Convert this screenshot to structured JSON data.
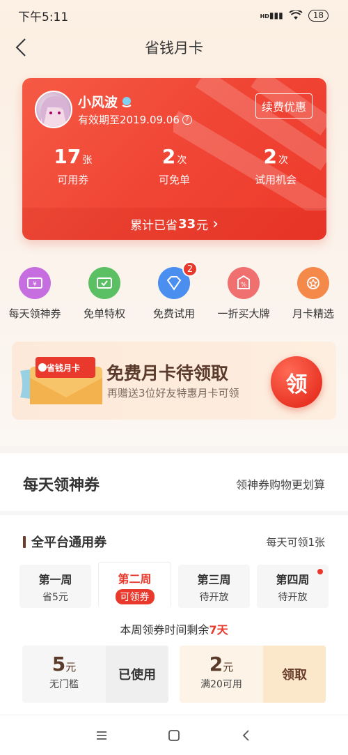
{
  "status_bar": {
    "time": "下午5:11",
    "network": "HD",
    "battery": "18"
  },
  "nav": {
    "title": "省钱月卡"
  },
  "card": {
    "user_name": "小风波",
    "validity": "有效期至2019.09.06",
    "help_icon": "?",
    "renew_label": "续费优惠",
    "stats": [
      {
        "num": "17",
        "unit": "张",
        "label": "可用券"
      },
      {
        "num": "2",
        "unit": "次",
        "label": "可免单"
      },
      {
        "num": "2",
        "unit": "次",
        "label": "试用机会"
      }
    ],
    "saved_prefix": "累计已省",
    "saved_amount": "33",
    "saved_suffix": "元",
    "saved_arrow": "›"
  },
  "functions": [
    {
      "label": "每天领神券",
      "icon": "coupon-icon",
      "color": "#c66ee0"
    },
    {
      "label": "免单特权",
      "icon": "check-ticket-icon",
      "color": "#5ac063"
    },
    {
      "label": "免费试用",
      "icon": "diamond-icon",
      "color": "#4a8ef0",
      "badge": "2"
    },
    {
      "label": "一折买大牌",
      "icon": "percent-tag-icon",
      "color": "#f07070"
    },
    {
      "label": "月卡精选",
      "icon": "star-badge-icon",
      "color": "#f5894a"
    }
  ],
  "promo": {
    "card_label": "省钱月卡",
    "title": "免费月卡待领取",
    "subtitle": "再赠送3位好友特惠月卡可领",
    "claim": "领"
  },
  "daily": {
    "title": "每天领神券",
    "subtitle": "领神券购物更划算",
    "section_title": "全平台通用券",
    "section_note": "每天可领1张",
    "weeks": [
      {
        "name": "第一周",
        "status": "省5元"
      },
      {
        "name": "第二周",
        "status": "可领券"
      },
      {
        "name": "第三周",
        "status": "待开放"
      },
      {
        "name": "第四周",
        "status": "待开放"
      }
    ],
    "remaining_prefix": "本周领券时间剩余",
    "remaining_days": "7天",
    "coupons": [
      {
        "amount": "5",
        "unit": "元",
        "cond": "无门槛",
        "action": "已使用"
      },
      {
        "amount": "2",
        "unit": "元",
        "cond": "满20可用",
        "action": "领取"
      }
    ]
  },
  "colors": {
    "accent": "#e8392c",
    "brown": "#5a3a2a"
  }
}
